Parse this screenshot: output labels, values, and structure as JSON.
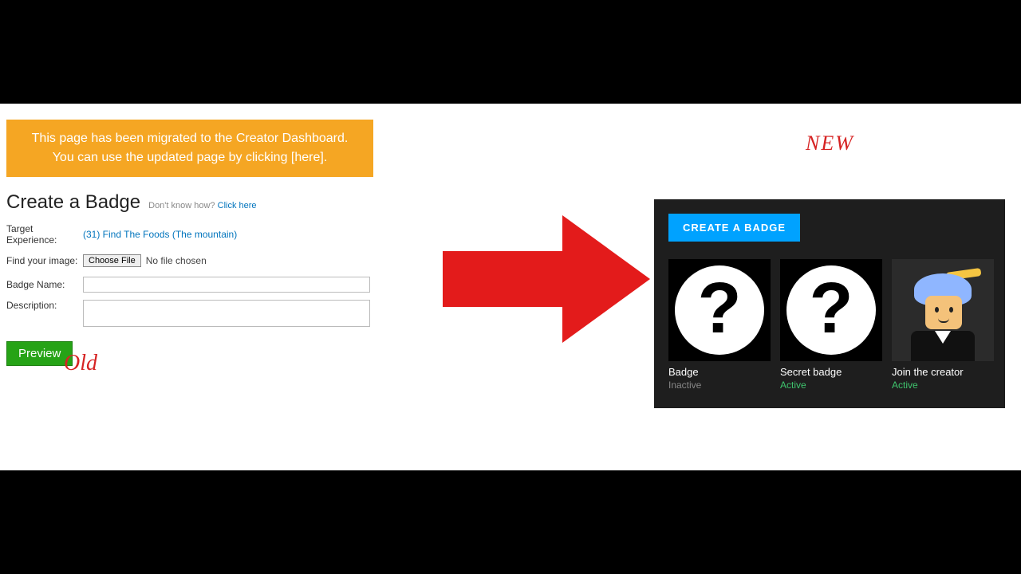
{
  "annotations": {
    "old": "Old",
    "new": "NEW"
  },
  "old_ui": {
    "banner": "This page has been migrated to the Creator Dashboard. You can use the updated page by clicking [here].",
    "heading": "Create a Badge",
    "hint_prefix": "Don't know how?",
    "hint_link": "Click here",
    "target_label": "Target Experience:",
    "target_value": "(31) Find The Foods (The mountain)",
    "image_label": "Find your image:",
    "choose_file_btn": "Choose File",
    "file_status": "No file chosen",
    "name_label": "Badge Name:",
    "desc_label": "Description:",
    "preview_btn": "Preview"
  },
  "new_ui": {
    "create_btn": "CREATE A BADGE",
    "badges": [
      {
        "name": "Badge",
        "status": "Inactive",
        "status_class": "status-inactive",
        "thumb": "question"
      },
      {
        "name": "Secret badge",
        "status": "Active",
        "status_class": "status-active",
        "thumb": "question"
      },
      {
        "name": "Join the creator",
        "status": "Active",
        "status_class": "status-active",
        "thumb": "avatar"
      }
    ]
  }
}
